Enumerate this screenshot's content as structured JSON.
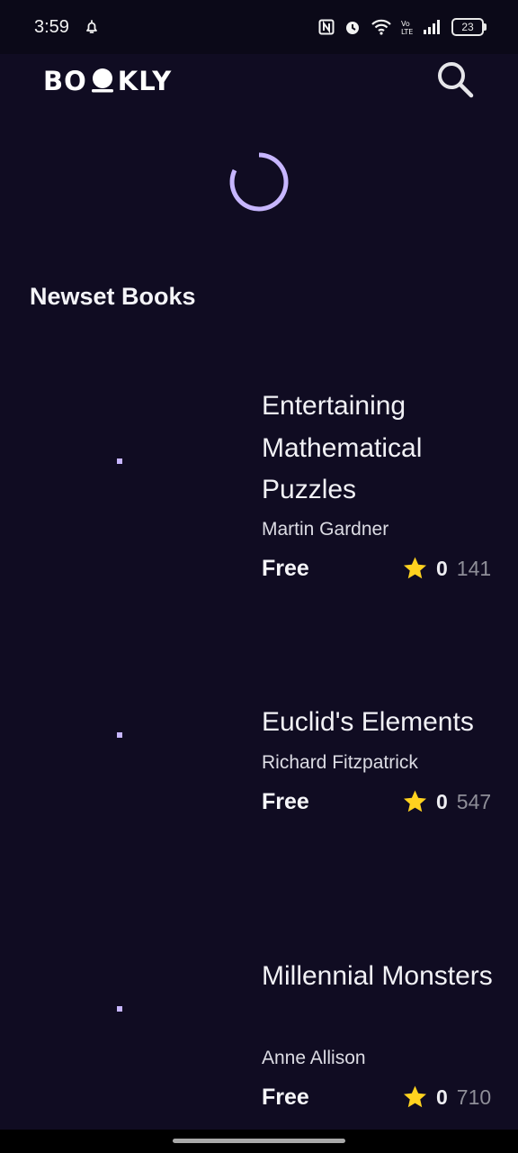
{
  "status_bar": {
    "time": "3:59",
    "battery": "23",
    "icons": [
      "notification-bell-icon",
      "nfc-icon",
      "alarm-icon",
      "wifi-icon",
      "volte-icon",
      "signal-icon",
      "battery-icon"
    ]
  },
  "header": {
    "logo_text_left": "BO",
    "logo_text_right": "KLY",
    "search_icon": "search-icon"
  },
  "loading": {
    "icon": "loading-spinner-icon"
  },
  "section": {
    "title": "Newset Books"
  },
  "books": [
    {
      "title": "Entertaining Mathematical Puzzles",
      "author": "Martin Gardner",
      "price": "Free",
      "rating": "0",
      "rating_count": "141"
    },
    {
      "title": "Euclid's Elements",
      "author": "Richard Fitzpatrick",
      "price": "Free",
      "rating": "0",
      "rating_count": "547"
    },
    {
      "title": "Millennial Monsters",
      "author": "Anne Allison",
      "price": "Free",
      "rating": "0",
      "rating_count": "710"
    }
  ],
  "colors": {
    "background": "#100c22",
    "accent": "#c7b6ff",
    "star": "#ffd21f"
  }
}
